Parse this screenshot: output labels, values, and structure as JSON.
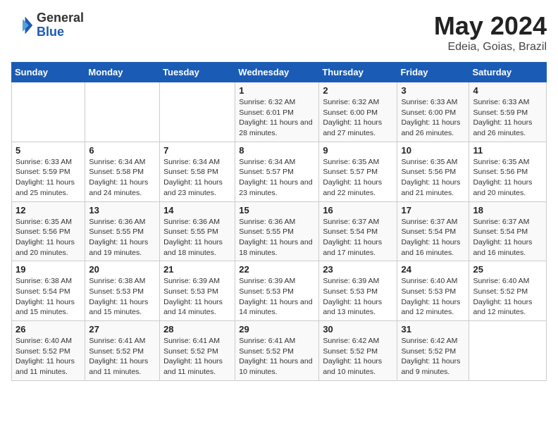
{
  "header": {
    "logo_general": "General",
    "logo_blue": "Blue",
    "month_title": "May 2024",
    "location": "Edeia, Goias, Brazil"
  },
  "days_of_week": [
    "Sunday",
    "Monday",
    "Tuesday",
    "Wednesday",
    "Thursday",
    "Friday",
    "Saturday"
  ],
  "weeks": [
    [
      {
        "day": "",
        "info": ""
      },
      {
        "day": "",
        "info": ""
      },
      {
        "day": "",
        "info": ""
      },
      {
        "day": "1",
        "info": "Sunrise: 6:32 AM\nSunset: 6:01 PM\nDaylight: 11 hours and 28 minutes."
      },
      {
        "day": "2",
        "info": "Sunrise: 6:32 AM\nSunset: 6:00 PM\nDaylight: 11 hours and 27 minutes."
      },
      {
        "day": "3",
        "info": "Sunrise: 6:33 AM\nSunset: 6:00 PM\nDaylight: 11 hours and 26 minutes."
      },
      {
        "day": "4",
        "info": "Sunrise: 6:33 AM\nSunset: 5:59 PM\nDaylight: 11 hours and 26 minutes."
      }
    ],
    [
      {
        "day": "5",
        "info": "Sunrise: 6:33 AM\nSunset: 5:59 PM\nDaylight: 11 hours and 25 minutes."
      },
      {
        "day": "6",
        "info": "Sunrise: 6:34 AM\nSunset: 5:58 PM\nDaylight: 11 hours and 24 minutes."
      },
      {
        "day": "7",
        "info": "Sunrise: 6:34 AM\nSunset: 5:58 PM\nDaylight: 11 hours and 23 minutes."
      },
      {
        "day": "8",
        "info": "Sunrise: 6:34 AM\nSunset: 5:57 PM\nDaylight: 11 hours and 23 minutes."
      },
      {
        "day": "9",
        "info": "Sunrise: 6:35 AM\nSunset: 5:57 PM\nDaylight: 11 hours and 22 minutes."
      },
      {
        "day": "10",
        "info": "Sunrise: 6:35 AM\nSunset: 5:56 PM\nDaylight: 11 hours and 21 minutes."
      },
      {
        "day": "11",
        "info": "Sunrise: 6:35 AM\nSunset: 5:56 PM\nDaylight: 11 hours and 20 minutes."
      }
    ],
    [
      {
        "day": "12",
        "info": "Sunrise: 6:35 AM\nSunset: 5:56 PM\nDaylight: 11 hours and 20 minutes."
      },
      {
        "day": "13",
        "info": "Sunrise: 6:36 AM\nSunset: 5:55 PM\nDaylight: 11 hours and 19 minutes."
      },
      {
        "day": "14",
        "info": "Sunrise: 6:36 AM\nSunset: 5:55 PM\nDaylight: 11 hours and 18 minutes."
      },
      {
        "day": "15",
        "info": "Sunrise: 6:36 AM\nSunset: 5:55 PM\nDaylight: 11 hours and 18 minutes."
      },
      {
        "day": "16",
        "info": "Sunrise: 6:37 AM\nSunset: 5:54 PM\nDaylight: 11 hours and 17 minutes."
      },
      {
        "day": "17",
        "info": "Sunrise: 6:37 AM\nSunset: 5:54 PM\nDaylight: 11 hours and 16 minutes."
      },
      {
        "day": "18",
        "info": "Sunrise: 6:37 AM\nSunset: 5:54 PM\nDaylight: 11 hours and 16 minutes."
      }
    ],
    [
      {
        "day": "19",
        "info": "Sunrise: 6:38 AM\nSunset: 5:54 PM\nDaylight: 11 hours and 15 minutes."
      },
      {
        "day": "20",
        "info": "Sunrise: 6:38 AM\nSunset: 5:53 PM\nDaylight: 11 hours and 15 minutes."
      },
      {
        "day": "21",
        "info": "Sunrise: 6:39 AM\nSunset: 5:53 PM\nDaylight: 11 hours and 14 minutes."
      },
      {
        "day": "22",
        "info": "Sunrise: 6:39 AM\nSunset: 5:53 PM\nDaylight: 11 hours and 14 minutes."
      },
      {
        "day": "23",
        "info": "Sunrise: 6:39 AM\nSunset: 5:53 PM\nDaylight: 11 hours and 13 minutes."
      },
      {
        "day": "24",
        "info": "Sunrise: 6:40 AM\nSunset: 5:53 PM\nDaylight: 11 hours and 12 minutes."
      },
      {
        "day": "25",
        "info": "Sunrise: 6:40 AM\nSunset: 5:52 PM\nDaylight: 11 hours and 12 minutes."
      }
    ],
    [
      {
        "day": "26",
        "info": "Sunrise: 6:40 AM\nSunset: 5:52 PM\nDaylight: 11 hours and 11 minutes."
      },
      {
        "day": "27",
        "info": "Sunrise: 6:41 AM\nSunset: 5:52 PM\nDaylight: 11 hours and 11 minutes."
      },
      {
        "day": "28",
        "info": "Sunrise: 6:41 AM\nSunset: 5:52 PM\nDaylight: 11 hours and 11 minutes."
      },
      {
        "day": "29",
        "info": "Sunrise: 6:41 AM\nSunset: 5:52 PM\nDaylight: 11 hours and 10 minutes."
      },
      {
        "day": "30",
        "info": "Sunrise: 6:42 AM\nSunset: 5:52 PM\nDaylight: 11 hours and 10 minutes."
      },
      {
        "day": "31",
        "info": "Sunrise: 6:42 AM\nSunset: 5:52 PM\nDaylight: 11 hours and 9 minutes."
      },
      {
        "day": "",
        "info": ""
      }
    ]
  ]
}
